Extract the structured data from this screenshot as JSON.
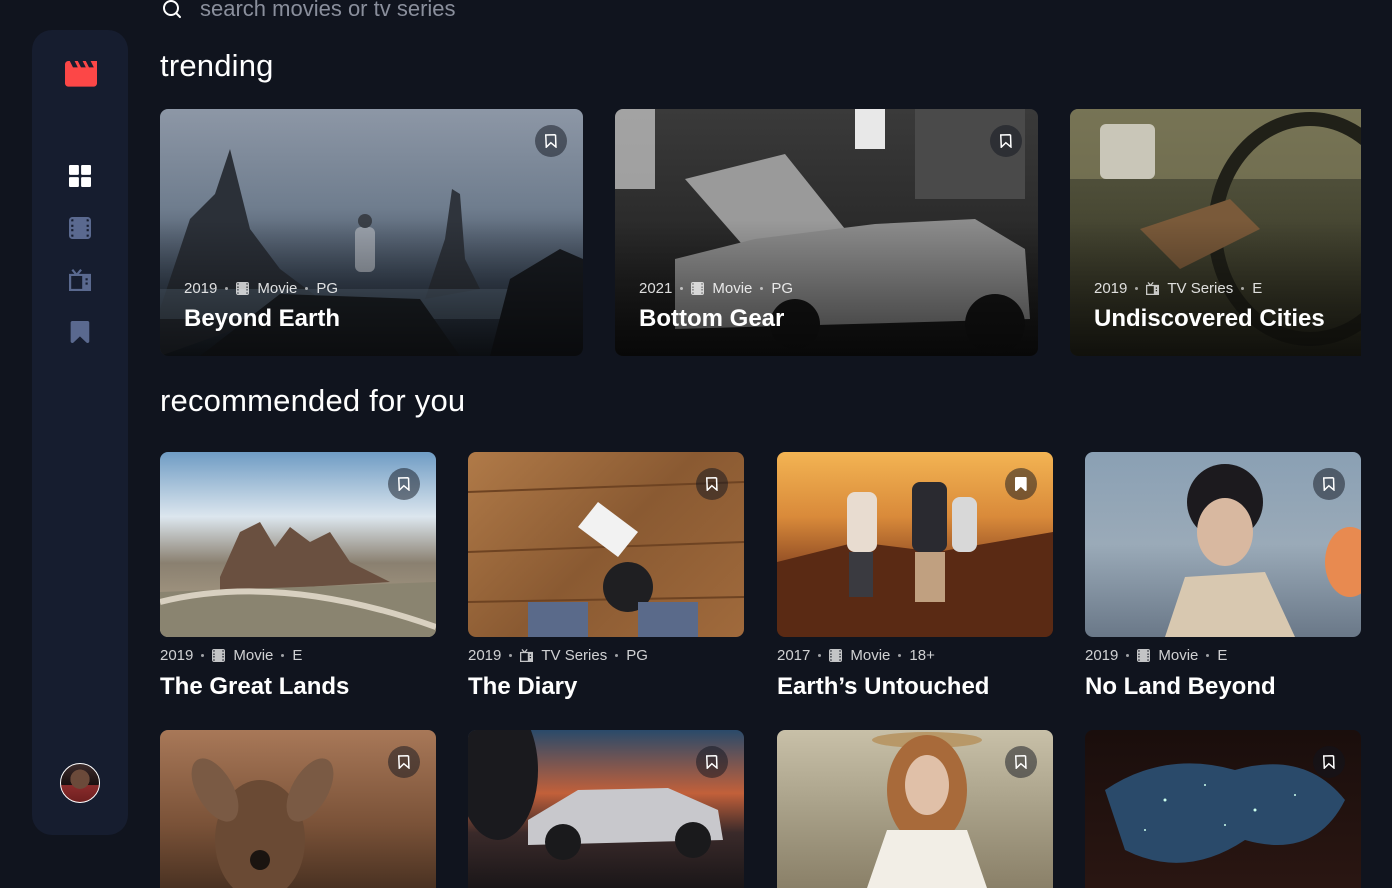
{
  "search": {
    "placeholder": "search movies or tv series"
  },
  "sections": {
    "trending": "trending",
    "recommended": "recommended for you"
  },
  "colors": {
    "accent": "#FC4747",
    "background": "#10141E",
    "sidebar": "#161D2F",
    "nav_active": "#FFFFFF",
    "nav_inactive": "#5A698F"
  },
  "nav": [
    {
      "name": "home",
      "icon": "grid-icon",
      "active": true
    },
    {
      "name": "movies",
      "icon": "film-icon",
      "active": false
    },
    {
      "name": "tv-series",
      "icon": "tv-icon",
      "active": false
    },
    {
      "name": "bookmarks",
      "icon": "bookmark-icon",
      "active": false
    }
  ],
  "trending": [
    {
      "year": "2019",
      "category": "Movie",
      "rating": "PG",
      "title": "Beyond Earth"
    },
    {
      "year": "2021",
      "category": "Movie",
      "rating": "PG",
      "title": "Bottom Gear"
    },
    {
      "year": "2019",
      "category": "TV Series",
      "rating": "E",
      "title": "Undiscovered Cities"
    }
  ],
  "recommended": [
    {
      "year": "2019",
      "category": "Movie",
      "rating": "E",
      "title": "The Great Lands"
    },
    {
      "year": "2019",
      "category": "TV Series",
      "rating": "PG",
      "title": "The Diary"
    },
    {
      "year": "2017",
      "category": "Movie",
      "rating": "18+",
      "title": "Earth’s Untouched"
    },
    {
      "year": "2019",
      "category": "Movie",
      "rating": "E",
      "title": "No Land Beyond"
    }
  ]
}
